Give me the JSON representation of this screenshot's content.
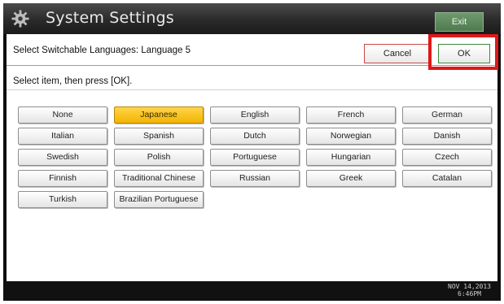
{
  "titlebar": {
    "title": "System Settings",
    "icon": "gear-icon",
    "exit_label": "Exit"
  },
  "header": {
    "text": "Select Switchable Languages: Language 5",
    "cancel_label": "Cancel",
    "ok_label": "OK"
  },
  "instruction": "Select item, then press [OK].",
  "languages": [
    {
      "label": "None",
      "selected": false
    },
    {
      "label": "Japanese",
      "selected": true
    },
    {
      "label": "English",
      "selected": false
    },
    {
      "label": "French",
      "selected": false
    },
    {
      "label": "German",
      "selected": false
    },
    {
      "label": "Italian",
      "selected": false
    },
    {
      "label": "Spanish",
      "selected": false
    },
    {
      "label": "Dutch",
      "selected": false
    },
    {
      "label": "Norwegian",
      "selected": false
    },
    {
      "label": "Danish",
      "selected": false
    },
    {
      "label": "Swedish",
      "selected": false
    },
    {
      "label": "Polish",
      "selected": false
    },
    {
      "label": "Portuguese",
      "selected": false
    },
    {
      "label": "Hungarian",
      "selected": false
    },
    {
      "label": "Czech",
      "selected": false
    },
    {
      "label": "Finnish",
      "selected": false
    },
    {
      "label": "Traditional Chinese",
      "selected": false
    },
    {
      "label": "Russian",
      "selected": false
    },
    {
      "label": "Greek",
      "selected": false
    },
    {
      "label": "Catalan",
      "selected": false
    },
    {
      "label": "Turkish",
      "selected": false
    },
    {
      "label": "Brazilian Portuguese",
      "selected": false
    }
  ],
  "status": {
    "date": "NOV  14,2013",
    "time": "6:46PM"
  },
  "colors": {
    "selected": "#f2b400",
    "highlight_box": "#e01818",
    "exit_button": "#4f7a4f"
  }
}
